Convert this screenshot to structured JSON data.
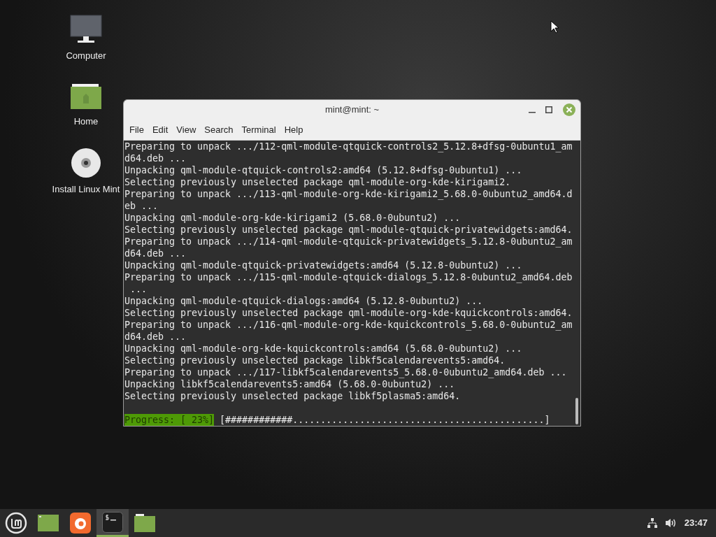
{
  "desktop_icons": [
    {
      "kind": "computer",
      "label": "Computer"
    },
    {
      "kind": "home",
      "label": "Home"
    },
    {
      "kind": "disc",
      "label": "Install Linux Mint"
    }
  ],
  "window": {
    "title": "mint@mint: ~",
    "menu": [
      "File",
      "Edit",
      "View",
      "Search",
      "Terminal",
      "Help"
    ],
    "lines": [
      "Preparing to unpack .../112-qml-module-qtquick-controls2_5.12.8+dfsg-0ubuntu1_am",
      "d64.deb ...",
      "Unpacking qml-module-qtquick-controls2:amd64 (5.12.8+dfsg-0ubuntu1) ...",
      "Selecting previously unselected package qml-module-org-kde-kirigami2.",
      "Preparing to unpack .../113-qml-module-org-kde-kirigami2_5.68.0-0ubuntu2_amd64.d",
      "eb ...",
      "Unpacking qml-module-org-kde-kirigami2 (5.68.0-0ubuntu2) ...",
      "Selecting previously unselected package qml-module-qtquick-privatewidgets:amd64.",
      "Preparing to unpack .../114-qml-module-qtquick-privatewidgets_5.12.8-0ubuntu2_am",
      "d64.deb ...",
      "Unpacking qml-module-qtquick-privatewidgets:amd64 (5.12.8-0ubuntu2) ...",
      "Preparing to unpack .../115-qml-module-qtquick-dialogs_5.12.8-0ubuntu2_amd64.deb",
      " ...",
      "Unpacking qml-module-qtquick-dialogs:amd64 (5.12.8-0ubuntu2) ...",
      "Selecting previously unselected package qml-module-org-kde-kquickcontrols:amd64.",
      "Preparing to unpack .../116-qml-module-org-kde-kquickcontrols_5.68.0-0ubuntu2_am",
      "d64.deb ...",
      "Unpacking qml-module-org-kde-kquickcontrols:amd64 (5.68.0-0ubuntu2) ...",
      "Selecting previously unselected package libkf5calendarevents5:amd64.",
      "Preparing to unpack .../117-libkf5calendarevents5_5.68.0-0ubuntu2_amd64.deb ...",
      "Unpacking libkf5calendarevents5:amd64 (5.68.0-0ubuntu2) ...",
      "Selecting previously unselected package libkf5plasma5:amd64."
    ],
    "progress_label": "Progress: [ 23%]",
    "progress_bar": "[############.............................................]"
  },
  "taskbar": {
    "items": [
      {
        "kind": "menu",
        "selected": false
      },
      {
        "kind": "desktop",
        "selected": false
      },
      {
        "kind": "browser",
        "selected": false
      },
      {
        "kind": "terminal",
        "selected": true
      },
      {
        "kind": "folder",
        "selected": false
      }
    ],
    "clock": "23:47"
  }
}
